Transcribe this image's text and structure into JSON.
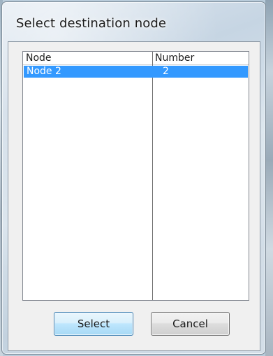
{
  "window": {
    "title": "Select destination node"
  },
  "listview": {
    "columns": [
      "Node",
      "Number"
    ],
    "rows": [
      {
        "node": "Node 2",
        "number": "2",
        "selected": true
      }
    ]
  },
  "buttons": {
    "select_label": "Select",
    "cancel_label": "Cancel"
  },
  "colors": {
    "selection": "#3399ff",
    "button_hover": "#bee6fd"
  }
}
